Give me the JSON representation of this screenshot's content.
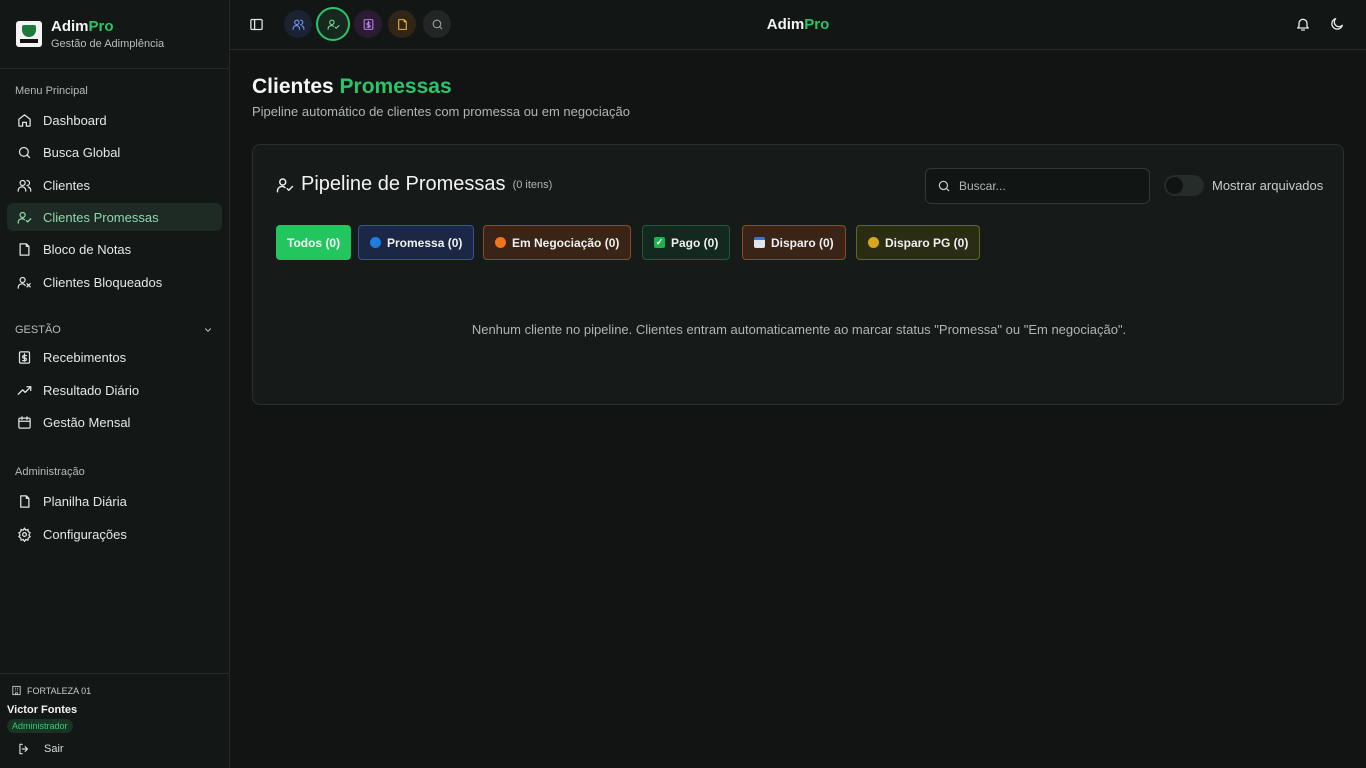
{
  "brand": {
    "name_main": "Adim",
    "name_accent": "Pro",
    "subtitle": "Gestão de Adimplência"
  },
  "sidebar": {
    "menu_label": "Menu Principal",
    "menu_items": [
      {
        "label": "Dashboard",
        "icon": "home-icon"
      },
      {
        "label": "Busca Global",
        "icon": "search-icon"
      },
      {
        "label": "Clientes",
        "icon": "users-icon"
      },
      {
        "label": "Clientes Promessas",
        "icon": "user-check-icon",
        "active": true
      },
      {
        "label": "Bloco de Notas",
        "icon": "note-icon"
      },
      {
        "label": "Clientes Bloqueados",
        "icon": "user-x-icon"
      }
    ],
    "gestao_label": "GESTÃO",
    "gestao_items": [
      {
        "label": "Recebimentos",
        "icon": "dollar-square-icon"
      },
      {
        "label": "Resultado Diário",
        "icon": "trending-up-icon"
      },
      {
        "label": "Gestão Mensal",
        "icon": "calendar-icon"
      }
    ],
    "admin_label": "Administração",
    "admin_items": [
      {
        "label": "Planilha Diária",
        "icon": "file-icon"
      },
      {
        "label": "Configurações",
        "icon": "gear-icon"
      }
    ],
    "footer": {
      "org": "FORTALEZA 01",
      "user": "Victor Fontes",
      "role": "Administrador",
      "logout": "Sair"
    }
  },
  "topbar": {
    "title_main": "Adim",
    "title_accent": "Pro",
    "quick_buttons": [
      "users-icon",
      "user-check-icon",
      "dollar-icon",
      "note-icon",
      "search-icon"
    ]
  },
  "page": {
    "title_main": "Clientes",
    "title_accent": "Promessas",
    "subtitle": "Pipeline automático de clientes com promessa ou em negociação"
  },
  "pipeline": {
    "title": "Pipeline de Promessas",
    "count": "(0 itens)",
    "search_placeholder": "Buscar...",
    "search_value": "",
    "toggle_label": "Mostrar arquivados",
    "toggle_on": false,
    "filters": [
      {
        "label": "Todos (0)",
        "active": true
      },
      {
        "label": "Promessa (0)",
        "icon": "blue-circle-icon"
      },
      {
        "label": "Em Negociação (0)",
        "icon": "orange-circle-icon"
      },
      {
        "label": "Pago (0)",
        "icon": "check-box-icon"
      },
      {
        "label": "Disparo (0)",
        "icon": "calendar-emoji-icon"
      },
      {
        "label": "Disparo PG (0)",
        "icon": "money-bag-icon"
      }
    ],
    "empty_message": "Nenhum cliente no pipeline. Clientes entram automaticamente ao marcar status \"Promessa\" ou \"Em negociação\"."
  },
  "colors": {
    "accent": "#2bc46a",
    "background": "#111413",
    "card": "#161a19"
  }
}
